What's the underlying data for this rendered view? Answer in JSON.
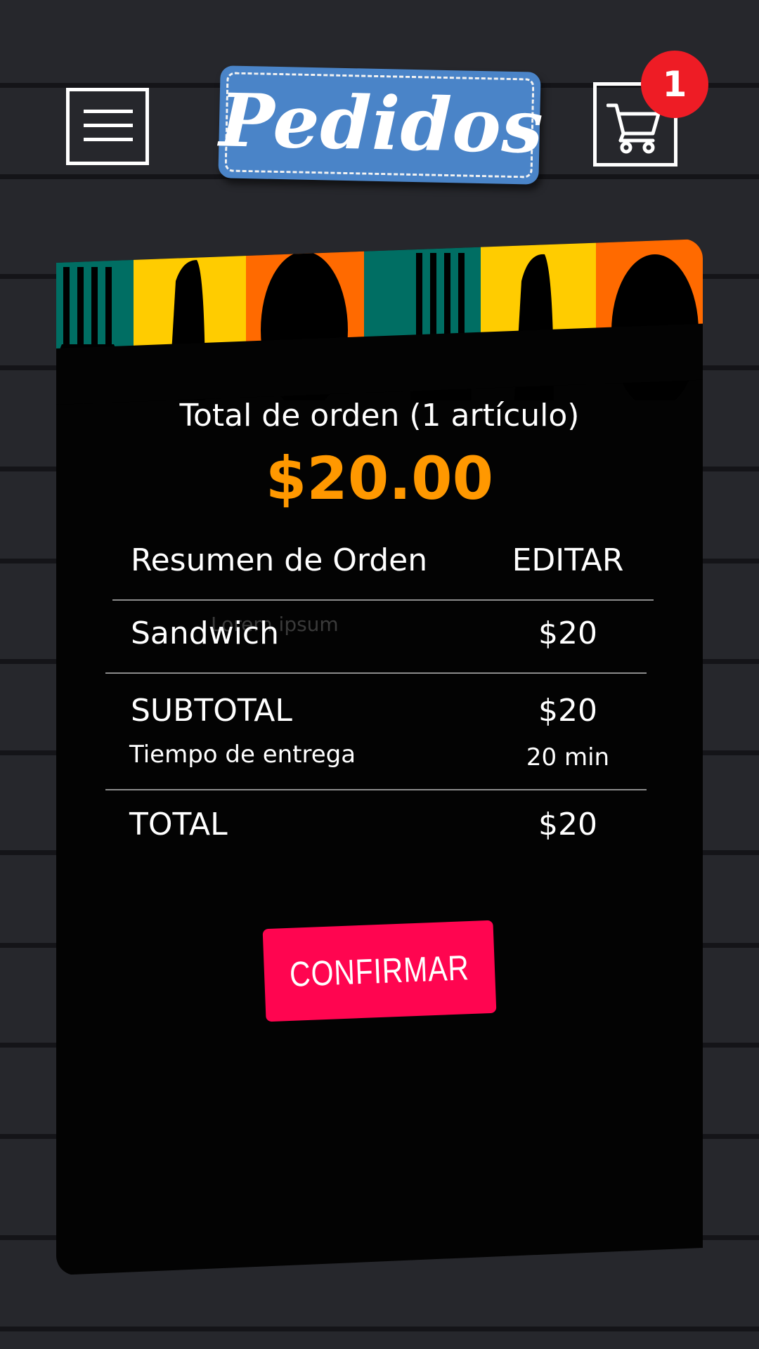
{
  "header": {
    "logo_text": "Pedidos",
    "cart_count": "1"
  },
  "icons": {
    "menu": "hamburger-menu-icon",
    "cart": "shopping-cart-icon"
  },
  "colors": {
    "background": "#26272c",
    "logo_blue": "#4a84c8",
    "badge_red": "#ee1c25",
    "amount_orange": "#ff9800",
    "confirm_pink": "#ff0550",
    "stripe_teal": "#006e63",
    "stripe_yellow": "#ffcc00",
    "stripe_orange": "#ff6a00"
  },
  "order": {
    "total_label": "Total de orden (1 artículo)",
    "total_amount": "$20.00",
    "summary_title": "Resumen de Orden",
    "edit_label": "EDITAR",
    "items": [
      {
        "name": "Sandwich",
        "price": "$20"
      }
    ],
    "ghost_text": "Lorem ipsum",
    "subtotal_label": "SUBTOTAL",
    "subtotal_value": "$20",
    "delivery_label": "Tiempo de entrega",
    "delivery_value": "20 min",
    "total_row_label": "TOTAL",
    "total_row_value": "$20"
  },
  "confirm_label": "CONFIRMAR"
}
